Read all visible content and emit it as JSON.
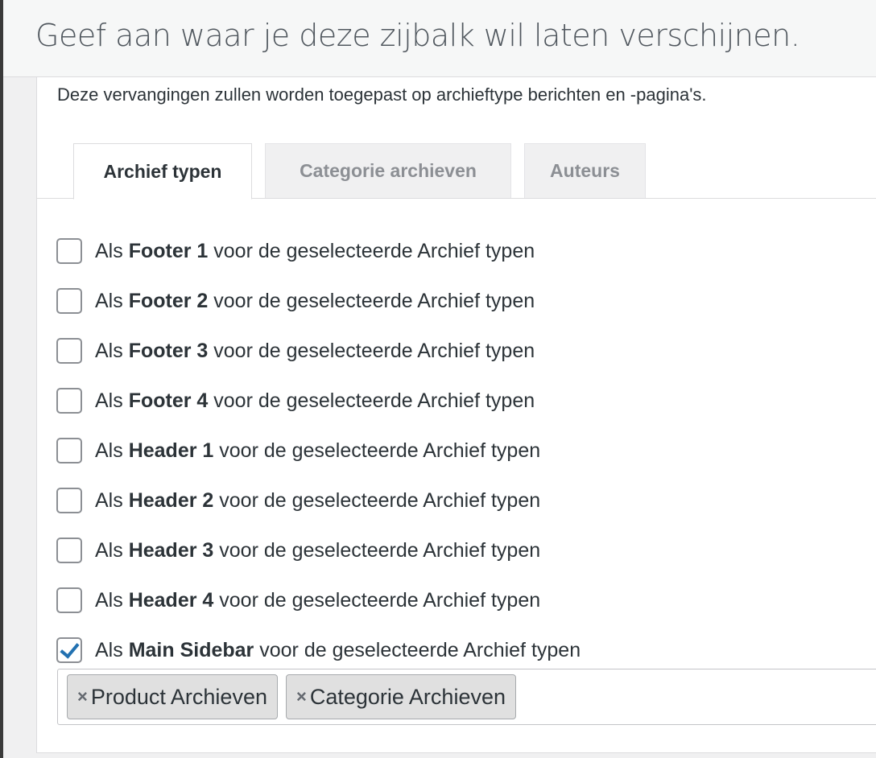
{
  "page": {
    "title": "Geef aan waar je deze zijbalk wil laten verschijnen."
  },
  "panel": {
    "description": "Deze vervangingen zullen worden toegepast op archieftype berichten en -pagina's."
  },
  "tabs": [
    {
      "label": "Archief typen",
      "active": true
    },
    {
      "label": "Categorie archieven",
      "active": false
    },
    {
      "label": "Auteurs",
      "active": false
    }
  ],
  "options": [
    {
      "prefix": "Als",
      "name": "Footer 1",
      "suffix": "voor de geselecteerde Archief typen",
      "checked": false
    },
    {
      "prefix": "Als",
      "name": "Footer 2",
      "suffix": "voor de geselecteerde Archief typen",
      "checked": false
    },
    {
      "prefix": "Als",
      "name": "Footer 3",
      "suffix": "voor de geselecteerde Archief typen",
      "checked": false
    },
    {
      "prefix": "Als",
      "name": "Footer 4",
      "suffix": "voor de geselecteerde Archief typen",
      "checked": false
    },
    {
      "prefix": "Als",
      "name": "Header 1",
      "suffix": "voor de geselecteerde Archief typen",
      "checked": false
    },
    {
      "prefix": "Als",
      "name": "Header 2",
      "suffix": "voor de geselecteerde Archief typen",
      "checked": false
    },
    {
      "prefix": "Als",
      "name": "Header 3",
      "suffix": "voor de geselecteerde Archief typen",
      "checked": false
    },
    {
      "prefix": "Als",
      "name": "Header 4",
      "suffix": "voor de geselecteerde Archief typen",
      "checked": false
    },
    {
      "prefix": "Als",
      "name": "Main Sidebar",
      "suffix": "voor de geselecteerde Archief typen",
      "checked": true
    }
  ],
  "selected_tags": [
    {
      "remove": "×",
      "label": "Product Archieven"
    },
    {
      "remove": "×",
      "label": "Categorie Archieven"
    }
  ],
  "colors": {
    "accent": "#2271b1",
    "text": "#2c3338",
    "muted": "#8c8f94"
  }
}
